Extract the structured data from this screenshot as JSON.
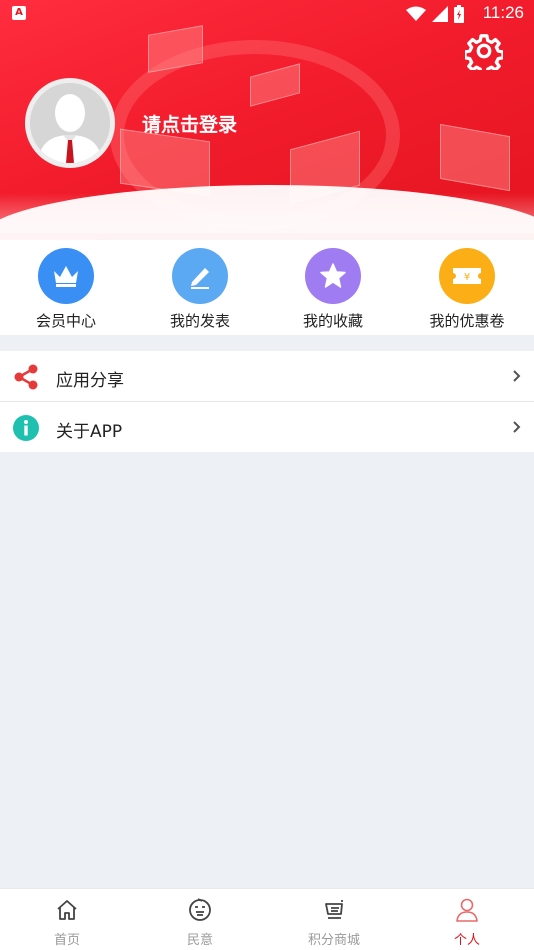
{
  "status_bar": {
    "time": "11:26",
    "app_badge": "A"
  },
  "header": {
    "login_prompt": "请点击登录",
    "settings_icon": "gear-icon"
  },
  "quick_menu": [
    {
      "label": "会员中心",
      "icon": "crown-icon",
      "color": "#3a8ff5"
    },
    {
      "label": "我的发表",
      "icon": "pencil-icon",
      "color": "#5aa9f2"
    },
    {
      "label": "我的收藏",
      "icon": "star-icon",
      "color": "#a07cf2"
    },
    {
      "label": "我的优惠卷",
      "icon": "coupon-icon",
      "color": "#fcae16"
    }
  ],
  "list": [
    {
      "label": "应用分享",
      "icon": "share-icon",
      "color": "#e43a3a"
    },
    {
      "label": "关于APP",
      "icon": "info-icon",
      "color": "#1fc0b0"
    }
  ],
  "bottom_nav": [
    {
      "label": "首页",
      "icon": "home-icon"
    },
    {
      "label": "民意",
      "icon": "opinion-icon"
    },
    {
      "label": "积分商城",
      "icon": "cart-icon"
    },
    {
      "label": "个人",
      "icon": "person-icon",
      "active": true
    }
  ],
  "colors": {
    "accent": "#e4141f",
    "background": "#edf0f5"
  }
}
